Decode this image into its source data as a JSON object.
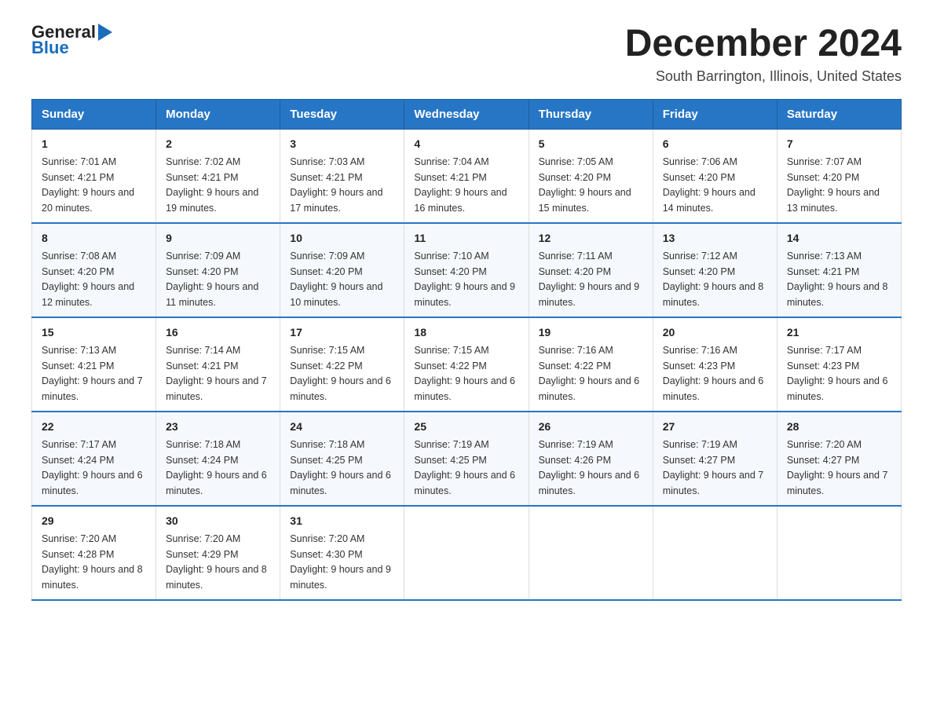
{
  "logo": {
    "text_general": "General",
    "text_blue": "Blue",
    "arrow": "▶"
  },
  "title": {
    "month_year": "December 2024",
    "location": "South Barrington, Illinois, United States"
  },
  "weekdays": [
    "Sunday",
    "Monday",
    "Tuesday",
    "Wednesday",
    "Thursday",
    "Friday",
    "Saturday"
  ],
  "weeks": [
    [
      {
        "day": "1",
        "sunrise": "7:01 AM",
        "sunset": "4:21 PM",
        "daylight": "9 hours and 20 minutes."
      },
      {
        "day": "2",
        "sunrise": "7:02 AM",
        "sunset": "4:21 PM",
        "daylight": "9 hours and 19 minutes."
      },
      {
        "day": "3",
        "sunrise": "7:03 AM",
        "sunset": "4:21 PM",
        "daylight": "9 hours and 17 minutes."
      },
      {
        "day": "4",
        "sunrise": "7:04 AM",
        "sunset": "4:21 PM",
        "daylight": "9 hours and 16 minutes."
      },
      {
        "day": "5",
        "sunrise": "7:05 AM",
        "sunset": "4:20 PM",
        "daylight": "9 hours and 15 minutes."
      },
      {
        "day": "6",
        "sunrise": "7:06 AM",
        "sunset": "4:20 PM",
        "daylight": "9 hours and 14 minutes."
      },
      {
        "day": "7",
        "sunrise": "7:07 AM",
        "sunset": "4:20 PM",
        "daylight": "9 hours and 13 minutes."
      }
    ],
    [
      {
        "day": "8",
        "sunrise": "7:08 AM",
        "sunset": "4:20 PM",
        "daylight": "9 hours and 12 minutes."
      },
      {
        "day": "9",
        "sunrise": "7:09 AM",
        "sunset": "4:20 PM",
        "daylight": "9 hours and 11 minutes."
      },
      {
        "day": "10",
        "sunrise": "7:09 AM",
        "sunset": "4:20 PM",
        "daylight": "9 hours and 10 minutes."
      },
      {
        "day": "11",
        "sunrise": "7:10 AM",
        "sunset": "4:20 PM",
        "daylight": "9 hours and 9 minutes."
      },
      {
        "day": "12",
        "sunrise": "7:11 AM",
        "sunset": "4:20 PM",
        "daylight": "9 hours and 9 minutes."
      },
      {
        "day": "13",
        "sunrise": "7:12 AM",
        "sunset": "4:20 PM",
        "daylight": "9 hours and 8 minutes."
      },
      {
        "day": "14",
        "sunrise": "7:13 AM",
        "sunset": "4:21 PM",
        "daylight": "9 hours and 8 minutes."
      }
    ],
    [
      {
        "day": "15",
        "sunrise": "7:13 AM",
        "sunset": "4:21 PM",
        "daylight": "9 hours and 7 minutes."
      },
      {
        "day": "16",
        "sunrise": "7:14 AM",
        "sunset": "4:21 PM",
        "daylight": "9 hours and 7 minutes."
      },
      {
        "day": "17",
        "sunrise": "7:15 AM",
        "sunset": "4:22 PM",
        "daylight": "9 hours and 6 minutes."
      },
      {
        "day": "18",
        "sunrise": "7:15 AM",
        "sunset": "4:22 PM",
        "daylight": "9 hours and 6 minutes."
      },
      {
        "day": "19",
        "sunrise": "7:16 AM",
        "sunset": "4:22 PM",
        "daylight": "9 hours and 6 minutes."
      },
      {
        "day": "20",
        "sunrise": "7:16 AM",
        "sunset": "4:23 PM",
        "daylight": "9 hours and 6 minutes."
      },
      {
        "day": "21",
        "sunrise": "7:17 AM",
        "sunset": "4:23 PM",
        "daylight": "9 hours and 6 minutes."
      }
    ],
    [
      {
        "day": "22",
        "sunrise": "7:17 AM",
        "sunset": "4:24 PM",
        "daylight": "9 hours and 6 minutes."
      },
      {
        "day": "23",
        "sunrise": "7:18 AM",
        "sunset": "4:24 PM",
        "daylight": "9 hours and 6 minutes."
      },
      {
        "day": "24",
        "sunrise": "7:18 AM",
        "sunset": "4:25 PM",
        "daylight": "9 hours and 6 minutes."
      },
      {
        "day": "25",
        "sunrise": "7:19 AM",
        "sunset": "4:25 PM",
        "daylight": "9 hours and 6 minutes."
      },
      {
        "day": "26",
        "sunrise": "7:19 AM",
        "sunset": "4:26 PM",
        "daylight": "9 hours and 6 minutes."
      },
      {
        "day": "27",
        "sunrise": "7:19 AM",
        "sunset": "4:27 PM",
        "daylight": "9 hours and 7 minutes."
      },
      {
        "day": "28",
        "sunrise": "7:20 AM",
        "sunset": "4:27 PM",
        "daylight": "9 hours and 7 minutes."
      }
    ],
    [
      {
        "day": "29",
        "sunrise": "7:20 AM",
        "sunset": "4:28 PM",
        "daylight": "9 hours and 8 minutes."
      },
      {
        "day": "30",
        "sunrise": "7:20 AM",
        "sunset": "4:29 PM",
        "daylight": "9 hours and 8 minutes."
      },
      {
        "day": "31",
        "sunrise": "7:20 AM",
        "sunset": "4:30 PM",
        "daylight": "9 hours and 9 minutes."
      },
      null,
      null,
      null,
      null
    ]
  ],
  "labels": {
    "sunrise": "Sunrise:",
    "sunset": "Sunset:",
    "daylight": "Daylight:"
  }
}
